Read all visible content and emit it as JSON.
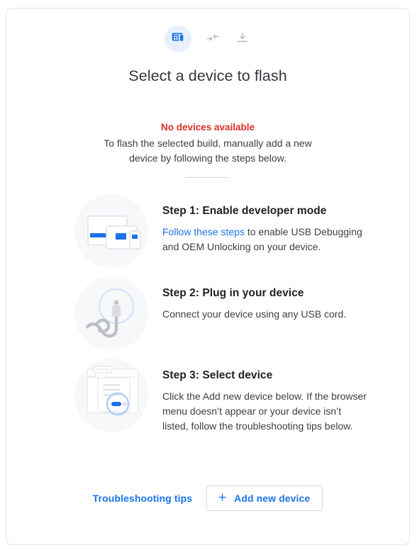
{
  "header": {
    "icons": [
      {
        "name": "devices-icon",
        "active": true
      },
      {
        "name": "transfer-arrows-icon",
        "active": false
      },
      {
        "name": "download-icon",
        "active": false
      }
    ],
    "title": "Select a device to flash"
  },
  "status": {
    "error": "No devices available",
    "description": "To flash the selected build, manually add a new device by following the steps below."
  },
  "steps": [
    {
      "art": "devices-illustration",
      "title": "Step 1: Enable developer mode",
      "link_text": "Follow these steps",
      "body_after_link": " to enable USB Debugging and OEM Unlocking on your device."
    },
    {
      "art": "usb-cable-illustration",
      "title": "Step 2: Plug in your device",
      "body": "Connect your device using any USB cord."
    },
    {
      "art": "browser-dialog-illustration",
      "title": "Step 3: Select device",
      "body": "Click the Add new device below. If the browser menu doesn’t appear or your device isn’t listed, follow the troubleshooting tips below."
    }
  ],
  "footer": {
    "troubleshooting_label": "Troubleshooting tips",
    "add_device_label": "Add new device"
  },
  "colors": {
    "accent_blue": "#1a73e8",
    "error_red": "#d93025",
    "icon_inactive": "#b9bdc2",
    "art_background": "#f7f8fa",
    "card_border": "#e4e4e5"
  }
}
